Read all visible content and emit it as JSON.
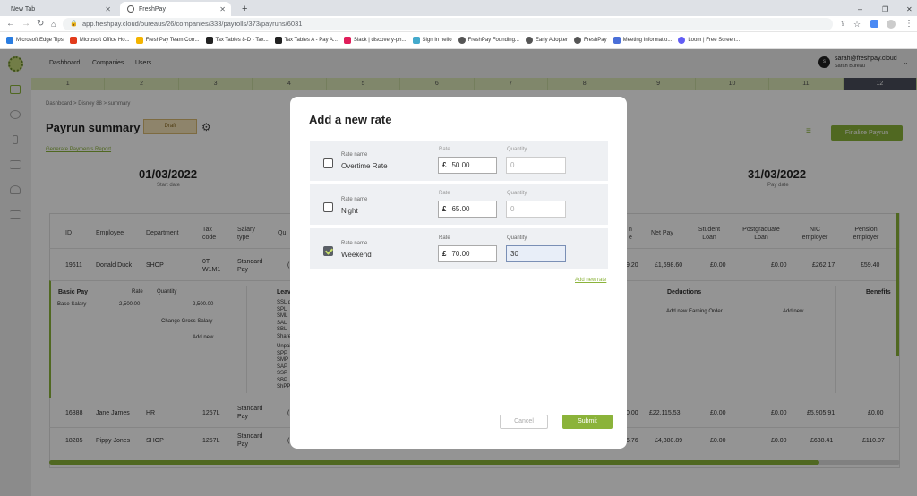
{
  "browser": {
    "tabs": [
      {
        "title": "New Tab"
      },
      {
        "title": "FreshPay"
      }
    ],
    "url": "app.freshpay.cloud/bureaus/26/companies/333/payrolls/373/payruns/6031",
    "bookmarks": [
      "Microsoft Edge Tips",
      "Microsoft Office Ho...",
      "FreshPay Team Corr...",
      "Tax Tables 8-D - Tax...",
      "Tax Tables A - Pay A...",
      "Slack | discovery-ph...",
      "Sign In hello",
      "FreshPay Founding...",
      "Early Adopter",
      "FreshPay",
      "Meeting Informatio...",
      "Loom | Free Screen..."
    ]
  },
  "nav": {
    "items": [
      "Dashboard",
      "Companies",
      "Users"
    ],
    "user_email": "sarah@freshpay.cloud",
    "user_org": "Sarah Bureau",
    "avatar_letter": "s"
  },
  "periods": [
    "1",
    "2",
    "3",
    "4",
    "5",
    "6",
    "7",
    "8",
    "9",
    "10",
    "11",
    "12"
  ],
  "page": {
    "breadcrumb": "Dashboard > Disney 88 > summary",
    "title": "Payrun summary",
    "status": "Draft",
    "report_link": "Generate Payments Report",
    "finalize": "Finalize Payrun",
    "start_date": "01/03/2022",
    "start_label": "Start date",
    "pay_date": "31/03/2022",
    "pay_label": "Pay date"
  },
  "table": {
    "headers": {
      "id": "ID",
      "employee": "Employee",
      "department": "Department",
      "tax_code": "Tax code",
      "salary_type": "Salary type",
      "qu": "Qu",
      "ne": "n e",
      "net_pay": "Net Pay",
      "student_loan": "Student Loan",
      "pg_loan": "Postgraduate Loan",
      "nic": "NIC employer",
      "pension": "Pension employer"
    },
    "rows": [
      {
        "id": "19611",
        "name": "Donald Duck",
        "dept": "SHOP",
        "tax": "0T W1M1",
        "salary": "Standard Pay",
        "q": "(",
        "ne": "9.20",
        "net": "£1,698.60",
        "student": "£0.00",
        "pg": "£0.00",
        "nic": "£262.17",
        "pension": "£59.40"
      },
      {
        "id": "16888",
        "name": "Jane James",
        "dept": "HR",
        "tax": "1257L",
        "salary": "Standard Pay",
        "q": "(",
        "ne": "0.00",
        "net": "£22,115.53",
        "student": "£0.00",
        "pg": "£0.00",
        "nic": "£5,905.91",
        "pension": "£0.00"
      },
      {
        "id": "18285",
        "name": "Pippy Jones",
        "dept": "SHOP",
        "tax": "1257L",
        "salary": "Standard Pay",
        "q": "(",
        "ne": "6.76",
        "net": "£4,380.89",
        "student": "£0.00",
        "pg": "£0.00",
        "nic": "£638.41",
        "pension": "£110.07"
      }
    ],
    "detail": {
      "basic_pay": "Basic Pay",
      "rate": "Rate",
      "quantity": "Quantity",
      "base_salary": "Base Salary",
      "base_rate": "2,500.00",
      "base_total": "2,500.00",
      "change_gross": "Change Gross Salary",
      "add_new": "Add new",
      "leave": "Leav",
      "leave_items": [
        "SSL d",
        "SPL",
        "SML",
        "SAL",
        "SBL",
        "Share"
      ],
      "unpaid": "Unpai",
      "unpaid_items": [
        "SPP",
        "SMP",
        "SAP",
        "SSP",
        "SBP",
        "ShPP"
      ],
      "deductions": "Deductions",
      "add_earning": "Add new Earning Order",
      "add_new_2": "Add new",
      "benefits": "Benefits"
    }
  },
  "modal": {
    "title": "Add a new rate",
    "rate_name_label": "Rate name",
    "rate_label": "Rate",
    "quantity_label": "Quantity",
    "currency": "£",
    "rates": [
      {
        "name": "Overtime Rate",
        "rate": "50.00",
        "quantity": "0",
        "checked": false
      },
      {
        "name": "Night",
        "rate": "65.00",
        "quantity": "0",
        "checked": false
      },
      {
        "name": "Weekend",
        "rate": "70.00",
        "quantity": "30",
        "checked": true
      }
    ],
    "add_new_rate": "Add new rate",
    "cancel": "Cancel",
    "submit": "Submit"
  }
}
